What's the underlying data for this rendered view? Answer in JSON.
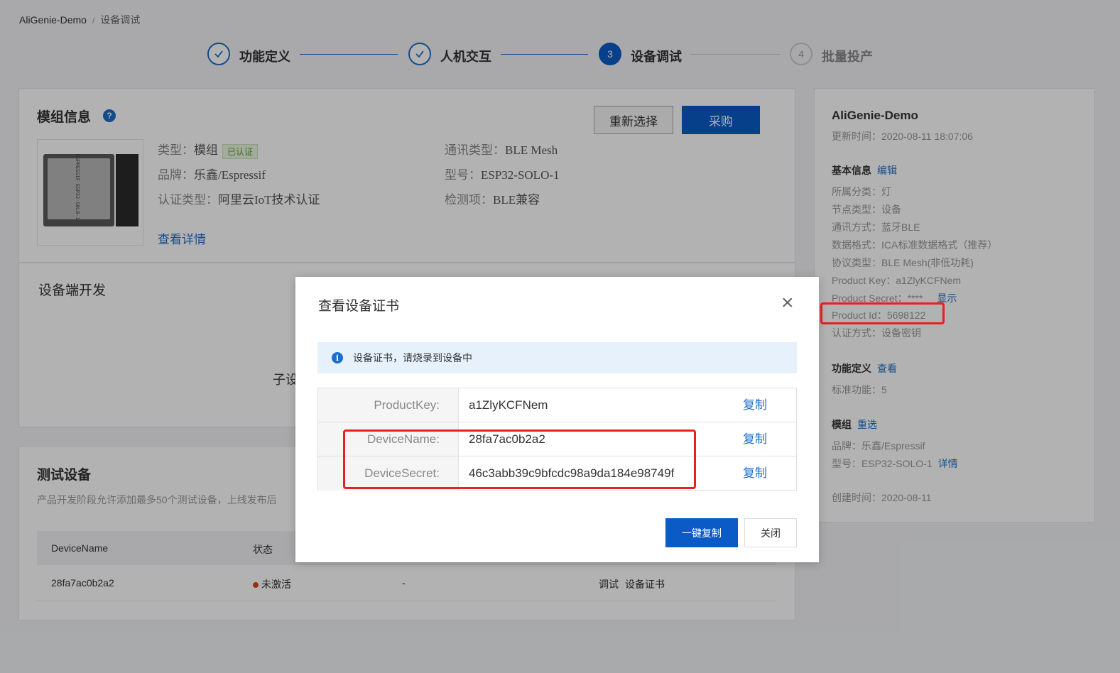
{
  "breadcrumb": {
    "root": "AliGenie-Demo",
    "separator": "/",
    "current": "设备调试"
  },
  "steps": [
    {
      "number": "",
      "label": "功能定义",
      "state": "done",
      "icon": "check-icon"
    },
    {
      "number": "",
      "label": "人机交互",
      "state": "done",
      "icon": "check-icon"
    },
    {
      "number": "3",
      "label": "设备调试",
      "state": "active"
    },
    {
      "number": "4",
      "label": "批量投产",
      "state": "todo"
    }
  ],
  "module": {
    "title": "模组信息",
    "help_icon": "?",
    "reselect_label": "重新选择",
    "purchase_label": "采购",
    "chip_text": "ESPRESSIF ESP32-S0L0-1",
    "type_label": "类型：",
    "type_value": "模组",
    "certified_badge": "已认证",
    "brand_label": "品牌：",
    "brand_value": "乐鑫/Espressif",
    "auth_label": "认证类型：",
    "auth_value": "阿里云IoT技术认证",
    "comm_label": "通讯类型：",
    "comm_value": "BLE Mesh",
    "model_label": "型号：",
    "model_value": "ESP32-SOLO-1",
    "check_label": "检测项：",
    "check_value": "BLE兼容",
    "details_link": "查看详情"
  },
  "device_dev": {
    "title": "设备端开发",
    "sub_partial": "子设"
  },
  "test_devices": {
    "title": "测试设备",
    "desc": "产品开发阶段允许添加最多50个测试设备，上线发布后",
    "headers": [
      "DeviceName",
      "状态"
    ],
    "rows": [
      {
        "device_name": "28fa7ac0b2a2",
        "status": "未激活",
        "extra": "-",
        "action_debug": "调试",
        "action_cert": "设备证书"
      }
    ]
  },
  "sidebar": {
    "product_name": "AliGenie-Demo",
    "updated": "更新时间：2020-08-11 18:07:06",
    "basic_info": "基本信息",
    "edit_link": "编辑",
    "category": "所属分类：灯",
    "node_type": "节点类型：设备",
    "comm_method": "通讯方式：蓝牙BLE",
    "data_format": "数据格式：ICA标准数据格式（推荐）",
    "protocol": "协议类型：BLE Mesh(非低功耗)",
    "product_key": "Product Key：a1ZlyKCFNem",
    "product_secret": "Product Secret：****",
    "show_link": "显示",
    "product_id": "Product Id：5698122",
    "auth_method": "认证方式：设备密钥",
    "func_def": "功能定义",
    "view_link": "查看",
    "std_func": "标准功能：5",
    "module_head": "模组",
    "reselect_link": "重选",
    "brand": "品牌：乐鑫/Espressif",
    "model": "型号：ESP32-SOLO-1",
    "details_link": "详情",
    "created": "创建时间：2020-08-11"
  },
  "modal": {
    "title": "查看设备证书",
    "close_icon": "×",
    "alert_icon": "i",
    "alert_text": "设备证书，请烧录到设备中",
    "rows": [
      {
        "key": "ProductKey:",
        "value": "a1ZlyKCFNem",
        "copy": "复制"
      },
      {
        "key": "DeviceName:",
        "value": "28fa7ac0b2a2",
        "copy": "复制"
      },
      {
        "key": "DeviceSecret:",
        "value": "46c3abb39c9bfcdc98a9da184e98749f",
        "copy": "复制"
      }
    ],
    "copy_all_label": "一键复制",
    "close_label": "关闭"
  },
  "colors": {
    "primary": "#0a5bc6",
    "link": "#1e6ec8",
    "highlight": "#e8201f",
    "inactive_status": "#e0441a"
  }
}
